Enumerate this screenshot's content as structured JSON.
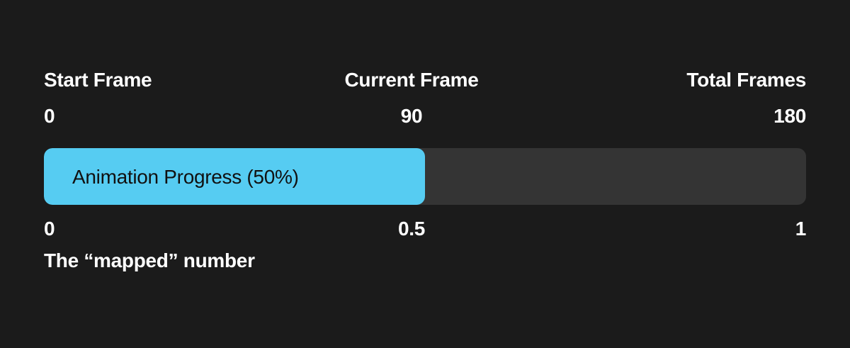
{
  "frames": {
    "start_label": "Start Frame",
    "current_label": "Current Frame",
    "total_label": "Total Frames",
    "start_value": "0",
    "current_value": "90",
    "total_value": "180"
  },
  "progress": {
    "label": "Animation Progress (50%)",
    "fraction": 0.5,
    "fill_color": "#56ccf2",
    "track_color": "#343434"
  },
  "mapped": {
    "min": "0",
    "mid": "0.5",
    "max": "1",
    "caption": "The “mapped” number"
  }
}
